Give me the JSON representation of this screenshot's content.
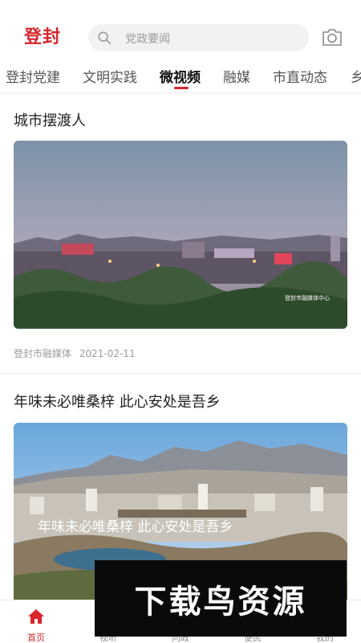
{
  "header": {
    "logo_text": "登封",
    "search_placeholder": "党政要闻"
  },
  "tabs": [
    {
      "label": "登封党建"
    },
    {
      "label": "文明实践"
    },
    {
      "label": "微视频"
    },
    {
      "label": "融媒"
    },
    {
      "label": "市直动态"
    },
    {
      "label": "乡"
    }
  ],
  "active_tab_index": 2,
  "articles": [
    {
      "title": "城市摆渡人",
      "watermark": "登封市融媒体中心",
      "source": "登封市融媒体",
      "date": "2021-02-11"
    },
    {
      "title": "年味未必唯桑梓  此心安处是吾乡",
      "overlay_text": "年味未必唯桑梓  此心安处是吾乡"
    }
  ],
  "bottom_nav": [
    {
      "label": "首页",
      "icon": "home-icon",
      "active": true
    },
    {
      "label": "视听",
      "icon": "video-icon",
      "active": false
    },
    {
      "label": "问政",
      "icon": "chat-icon",
      "active": false
    },
    {
      "label": "便民",
      "icon": "grid-icon",
      "active": false
    },
    {
      "label": "我的",
      "icon": "user-icon",
      "active": false
    }
  ],
  "overlay_banner": "下载鸟资源",
  "colors": {
    "accent": "#d9252c",
    "text_muted": "#9b9b9b"
  }
}
